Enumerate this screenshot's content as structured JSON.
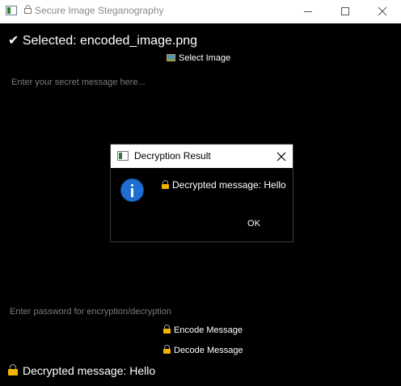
{
  "window": {
    "title": "Secure Image Steganography",
    "title_icon": "app-icon"
  },
  "selected_label": "✔ Selected: encoded_image.png",
  "select_image_button": "Select Image",
  "message_input": {
    "placeholder": "Enter your secret message here...",
    "value": ""
  },
  "password_input": {
    "placeholder": "Enter password for encryption/decryption",
    "value": ""
  },
  "encode_button": "Encode Message",
  "decode_button": "Decode Message",
  "status_label": "Decrypted message: Hello",
  "dialog": {
    "title": "Decryption Result",
    "message": "Decrypted message: Hello",
    "ok_label": "OK",
    "icon": "info-icon"
  },
  "colors": {
    "background": "#000000",
    "text": "#ffffff",
    "placeholder": "#7a7a7a",
    "lock_accent": "#f2b400",
    "info_blue": "#1f6fd1"
  }
}
